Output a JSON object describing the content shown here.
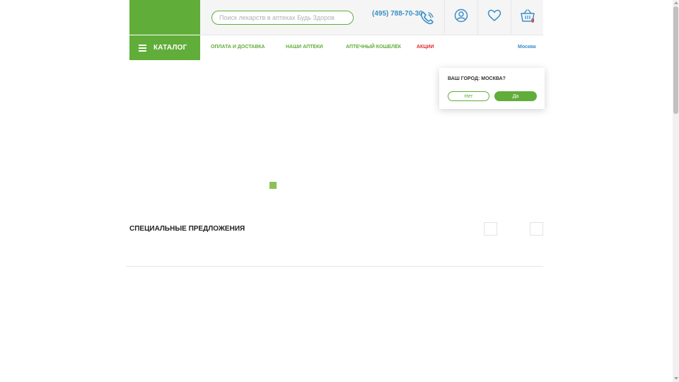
{
  "header": {
    "search_placeholder": "Поиск лекарств в аптеках Будь Здоров",
    "phone": "(495) 788-70-30",
    "cart_count": "0"
  },
  "nav": {
    "catalog_label": "КАТАЛОГ",
    "links": [
      {
        "label": "ОПЛАТА И ДОСТАВКА"
      },
      {
        "label": "НАШИ АПТЕКИ"
      },
      {
        "label": "АПТЕЧНЫЙ КОШЕЛЁК"
      },
      {
        "label": "АКЦИИ"
      }
    ],
    "city": "Москва"
  },
  "city_popup": {
    "question": "ВАШ ГОРОД: МОСКВА?",
    "no_label": "Нет",
    "yes_label": "Да"
  },
  "special_offers": {
    "title": "СПЕЦИАЛЬНЫЕ ПРЕДЛОЖЕНИЯ"
  },
  "colors": {
    "brand_green": "#61ad3a",
    "link_blue": "#3a8fc7",
    "promo_red": "#e02b2b"
  },
  "icons": [
    "menu-icon",
    "phone-icon",
    "account-icon",
    "heart-icon",
    "cart-icon"
  ]
}
